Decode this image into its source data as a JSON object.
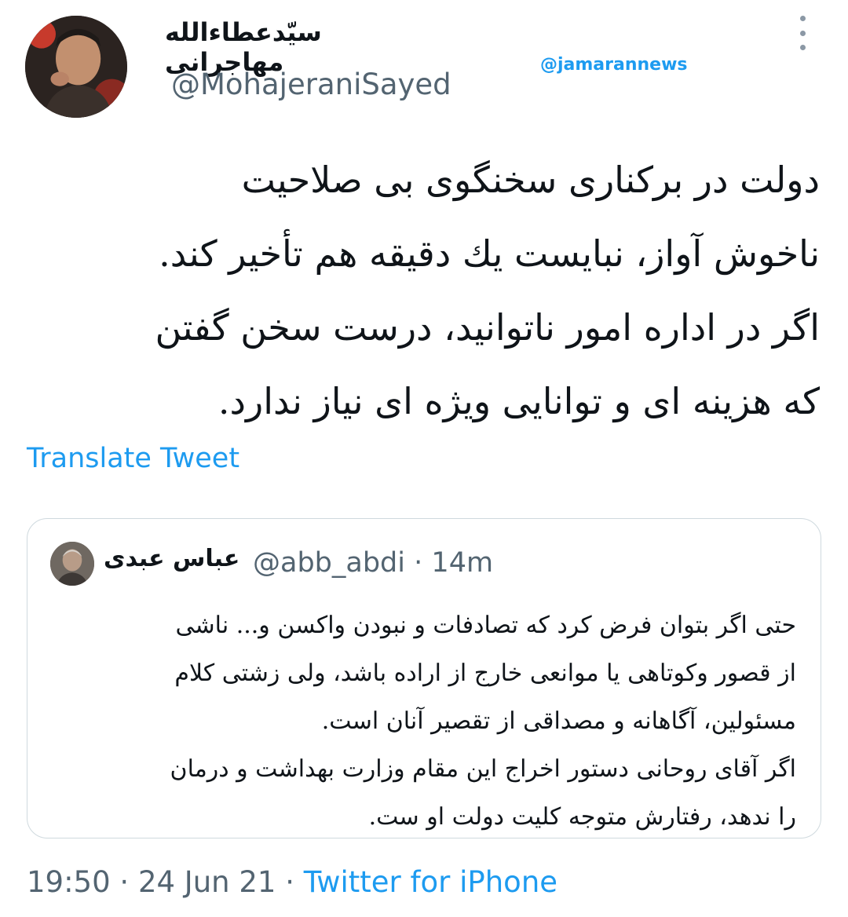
{
  "author": {
    "name": "سیّدعطاءالله مهاجرانی",
    "handle": "@MohajeraniSayed"
  },
  "watermark": "@jamarannews",
  "tweet": {
    "lines": [
      "دولت در برکناری سخنگوی بی صلاحیت",
      "ناخوش آواز، نبایست یك دقیقه هم تأخیر کند.",
      "اگر در اداره امور  ناتوانید، درست سخن گفتن",
      "که هزینه ای و توانایی ویژه ای نیاز ندارد."
    ],
    "translate_label": "Translate Tweet"
  },
  "quoted": {
    "name": "عباس عبدی",
    "handle": "@abb_abdi",
    "separator": "·",
    "time": "14m",
    "lines": [
      "حتی اگر بتوان فرض کرد که تصادفات و نبودن واکسن و... ناشی",
      "از قصور وکوتاهی یا موانعی خارج از اراده باشد، ولی زشتی کلام",
      "مسئولین، آگاهانه و مصداقی از تقصیر آنان است.",
      "اگر آقای روحانی دستور اخراج این مقام وزارت بهداشت و درمان",
      "را ندهد، رفتارش متوجه کلیت دولت او ست."
    ]
  },
  "footer": {
    "time": "19:50",
    "sep1": "·",
    "date": "24 Jun 21",
    "sep2": "·",
    "source": "Twitter for iPhone"
  },
  "icons": {
    "more": "more-vertical-icon"
  },
  "colors": {
    "accent": "#1d9bf0",
    "secondary_text": "#536471",
    "border": "#cfd9de"
  }
}
